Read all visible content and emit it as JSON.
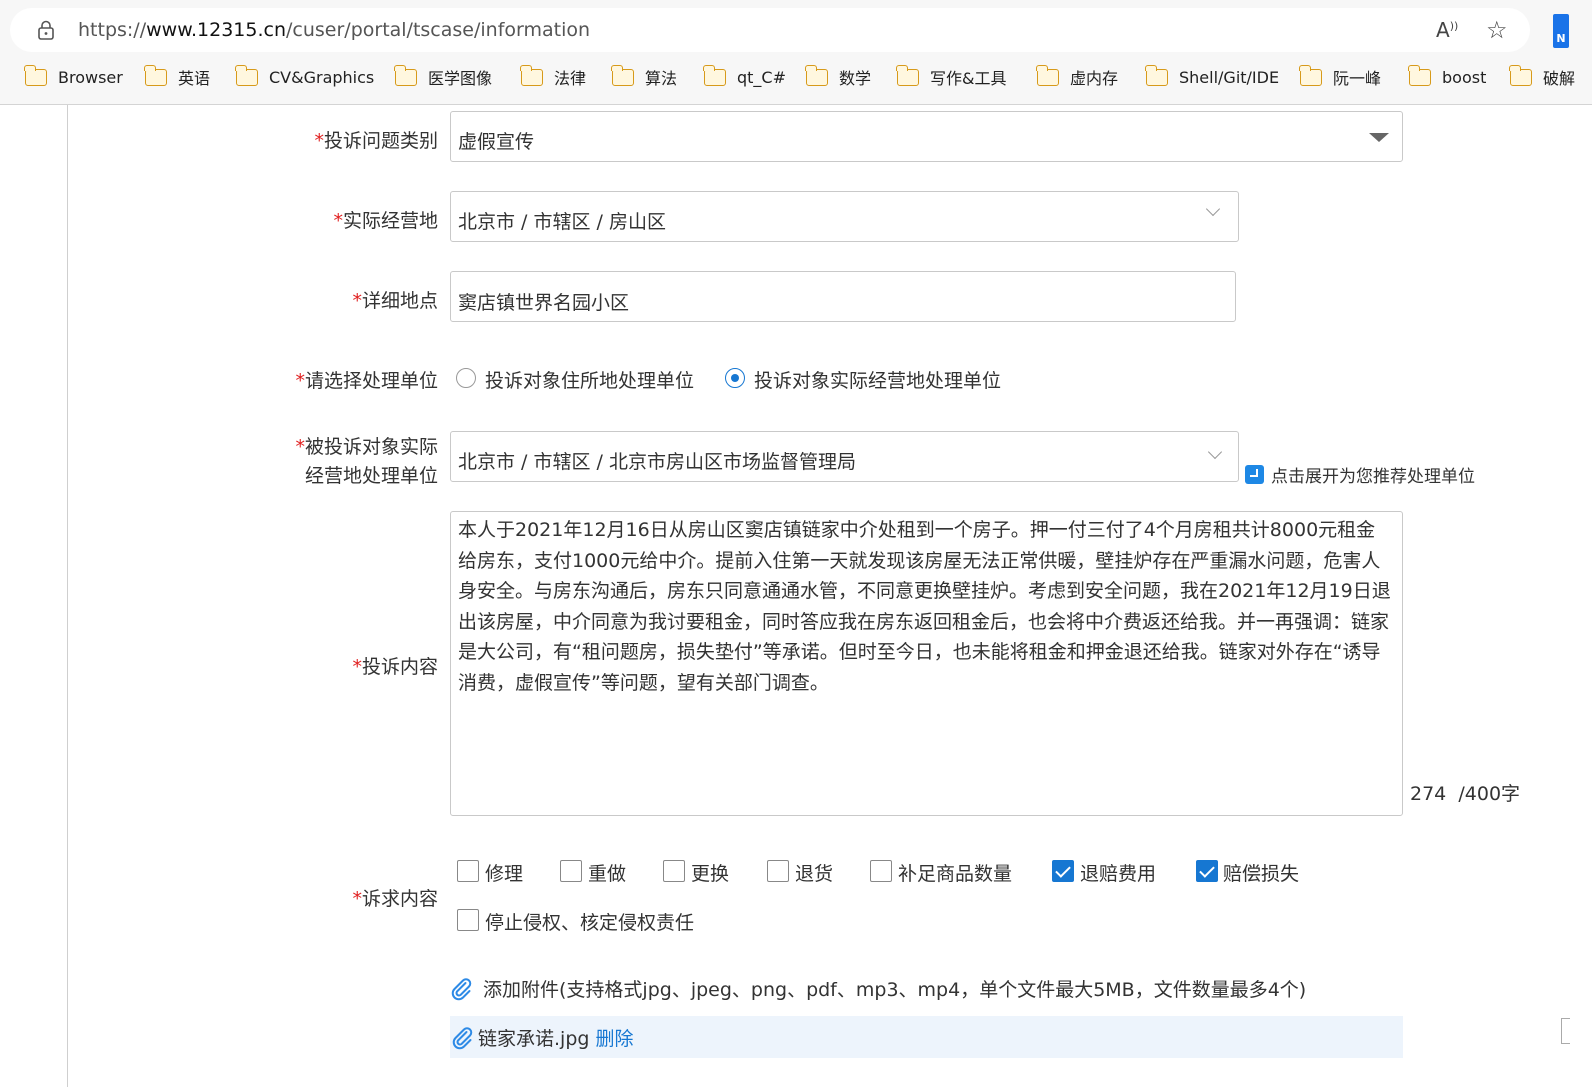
{
  "browser": {
    "url_prefix": "https://",
    "url_host": "www.12315.cn",
    "url_path": "/cuser/portal/tscase/information",
    "read_aloud_icon": "read-aloud-icon",
    "favorites_icon": "add-favorite-icon",
    "profile_badge": "N",
    "bookmarks": [
      "Browser",
      "英语",
      "CV&Graphics",
      "医学图像",
      "法律",
      "算法",
      "qt_C#",
      "数学",
      "写作&工具",
      "虚内存",
      "Shell/Git/IDE",
      "阮一峰",
      "boost",
      "破解"
    ]
  },
  "form": {
    "required_mark": "*",
    "category": {
      "label": "投诉问题类别",
      "value": "虚假宣传"
    },
    "location": {
      "label": "实际经营地",
      "value": "北京市 / 市辖区 / 房山区"
    },
    "address": {
      "label": "详细地点",
      "value": "窦店镇世界名园小区"
    },
    "handler_choice": {
      "label": "请选择处理单位",
      "options": [
        "投诉对象住所地处理单位",
        "投诉对象实际经营地处理单位"
      ],
      "selected_index": 1
    },
    "handler_unit": {
      "label_line1": "被投诉对象实际",
      "label_line2": "经营地处理单位",
      "value": "北京市 / 市辖区 / 北京市房山区市场监督管理局",
      "recommend_text": "点击展开为您推荐处理单位"
    },
    "complaint": {
      "label": "投诉内容",
      "text": "本人于2021年12月16日从房山区窦店镇链家中介处租到一个房子。押一付三付了4个月房租共计8000元租金给房东，支付1000元给中介。提前入住第一天就发现该房屋无法正常供暖，壁挂炉存在严重漏水问题，危害人身安全。与房东沟通后，房东只同意通通水管，不同意更换壁挂炉。考虑到安全问题，我在2021年12月19日退出该房屋，中介同意为我讨要租金，同时答应我在房东返回租金后，也会将中介费返还给我。并一再强调：链家是大公司，有“租问题房，损失垫付”等承诺。但时至今日，也未能将租金和押金退还给我。链家对外存在“诱导消费，虚假宣传”等问题，望有关部门调查。",
      "count": "274",
      "max": "/400字"
    },
    "demands": {
      "label": "诉求内容",
      "options": [
        {
          "label": "修理",
          "checked": false
        },
        {
          "label": "重做",
          "checked": false
        },
        {
          "label": "更换",
          "checked": false
        },
        {
          "label": "退货",
          "checked": false
        },
        {
          "label": "补足商品数量",
          "checked": false
        },
        {
          "label": "退赔费用",
          "checked": true
        },
        {
          "label": "赔偿损失",
          "checked": true
        },
        {
          "label": "停止侵权、核定侵权责任",
          "checked": false
        }
      ]
    },
    "attachment": {
      "add_text": "添加附件(支持格式jpg、jpeg、png、pdf、mp3、mp4，单个文件最大5MB，文件数量最多4个)",
      "file_name": "链家承诺.jpg",
      "delete_text": "删除"
    }
  }
}
